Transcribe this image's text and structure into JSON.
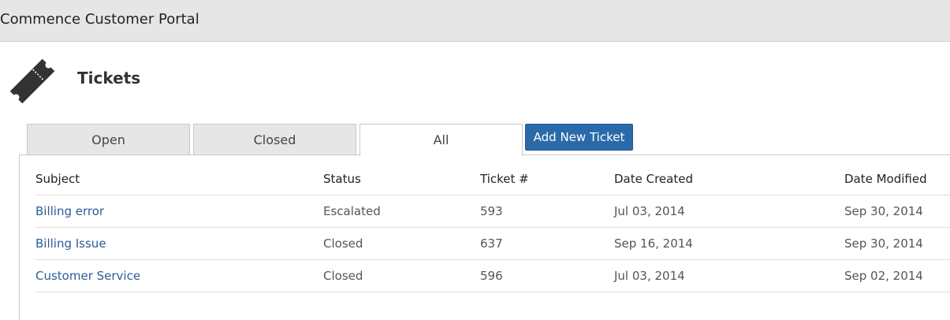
{
  "app": {
    "title": "Commence Customer Portal"
  },
  "page": {
    "title": "Tickets",
    "icon": "ticket-icon"
  },
  "tabs": [
    {
      "label": "Open",
      "active": false
    },
    {
      "label": "Closed",
      "active": false
    },
    {
      "label": "All",
      "active": true
    }
  ],
  "add_button": {
    "label": "Add New Ticket",
    "color": "#2a6aa8"
  },
  "table": {
    "columns": [
      "Subject",
      "Status",
      "Ticket #",
      "Date Created",
      "Date Modified"
    ],
    "rows": [
      {
        "subject": "Billing error",
        "status": "Escalated",
        "number": "593",
        "created": "Jul 03, 2014",
        "modified": "Sep 30, 2014"
      },
      {
        "subject": "Billing Issue",
        "status": "Closed",
        "number": "637",
        "created": "Sep 16, 2014",
        "modified": "Sep 30, 2014"
      },
      {
        "subject": "Customer Service",
        "status": "Closed",
        "number": "596",
        "created": "Jul 03, 2014",
        "modified": "Sep 02, 2014"
      }
    ]
  },
  "colors": {
    "topbar": "#e6e6e6",
    "link": "#2a5d9a",
    "accent": "#2a6aa8"
  }
}
